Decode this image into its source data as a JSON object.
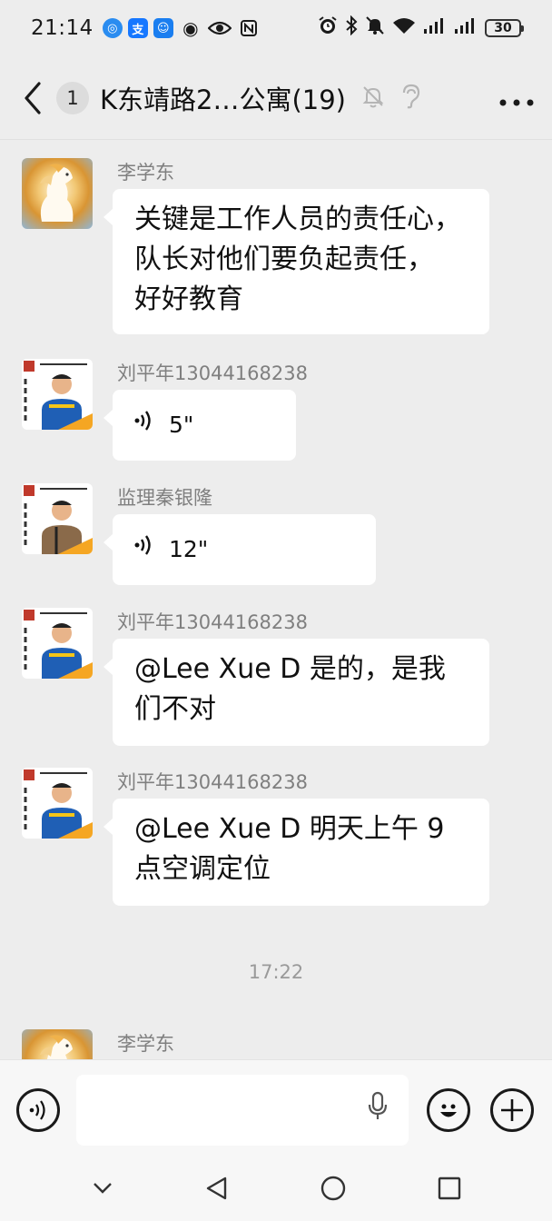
{
  "status_bar": {
    "time": "21:14",
    "battery": "30"
  },
  "header": {
    "unread_count": "1",
    "title": "K东靖路2…公寓(19)"
  },
  "messages": [
    {
      "sender": "李学东",
      "text_lines": [
        "关键是工作人员的责任心，",
        "队长对他们要负起责任，",
        "好好教育"
      ]
    },
    {
      "sender": "刘平年13044168238",
      "voice_duration": "5\""
    },
    {
      "sender": "监理秦银隆",
      "voice_duration": "12\""
    },
    {
      "sender": "刘平年13044168238",
      "text_lines": [
        "@Lee Xue D  是的，是我",
        "们不对"
      ]
    },
    {
      "sender": "刘平年13044168238",
      "text_lines": [
        "@Lee Xue D  明天上午 9",
        "点空调定位"
      ]
    },
    {
      "time_separator": "17:22"
    },
    {
      "sender": "李学东"
    }
  ],
  "input_bar": {
    "placeholder": ""
  },
  "colors": {
    "background": "#ededed",
    "bubble": "#ffffff",
    "sender": "#7f7f7f",
    "accent_orange": "#f5a623",
    "accent_blue": "#1f5fb5"
  }
}
